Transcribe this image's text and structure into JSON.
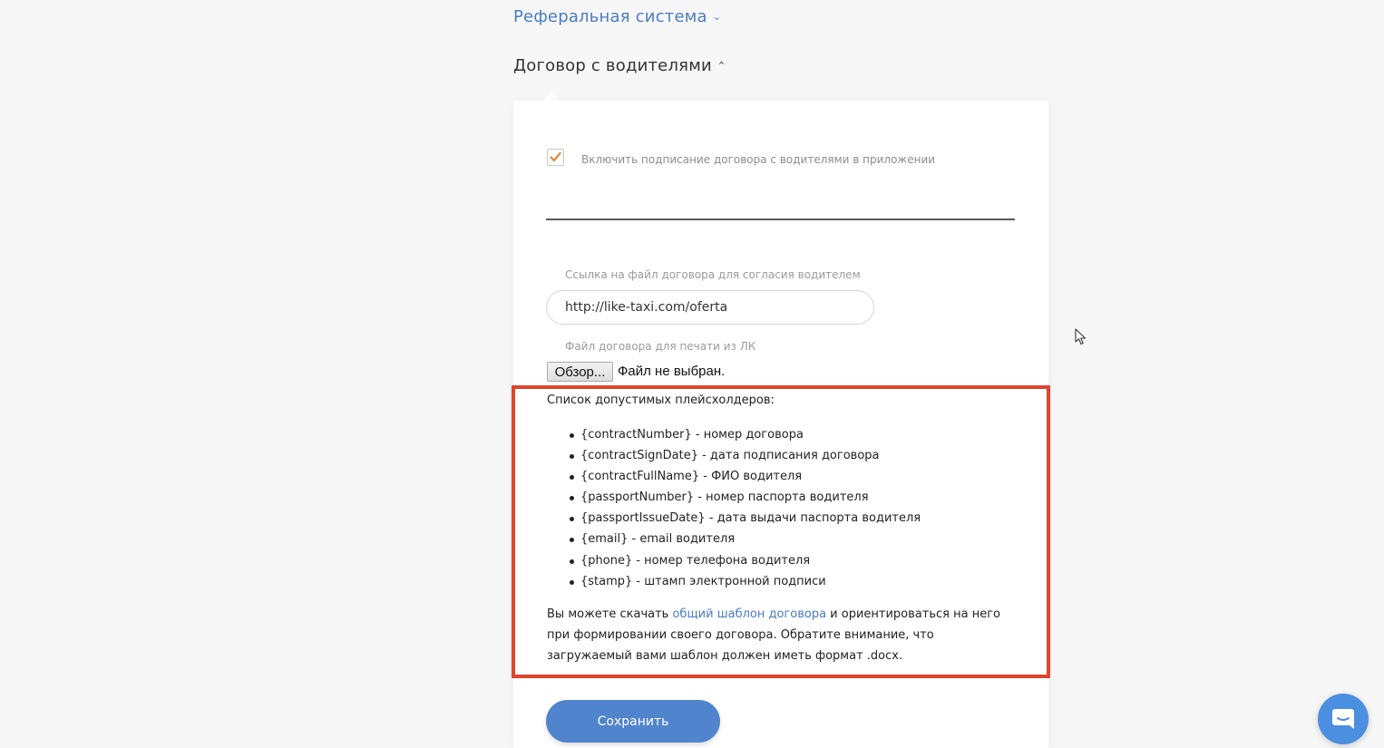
{
  "sections": {
    "referral": {
      "label": "Реферальная система",
      "chevron": "chevron-down-icon"
    },
    "contract": {
      "label": "Договор с водителями",
      "chevron": "chevron-up-icon"
    }
  },
  "settings": {
    "enable_signing": {
      "label": "Включить подписание договора с водителями в приложении",
      "checked": true
    },
    "contract_link": {
      "label": "Ссылка на файл договора для согласия водителем",
      "value": "http://like-taxi.com/oferta"
    },
    "print_file": {
      "label": "Файл договора для печати из ЛК",
      "browse_label": "Обзор...",
      "status": "Файл не выбран."
    }
  },
  "placeholders": {
    "title": "Список допустимых плейсхолдеров:",
    "items": [
      "{contractNumber} - номер договора",
      "{contractSignDate} - дата подписания договора",
      "{contractFullName} - ФИО водителя",
      "{passportNumber} - номер паспорта водителя",
      "{passportIssueDate} - дата выдачи паспорта водителя",
      "{email} - email водителя",
      "{phone} - номер телефона водителя",
      "{stamp} - штамп электронной подписи"
    ]
  },
  "note": {
    "before": "Вы можете скачать ",
    "link": "общий шаблон договора",
    "after": " и ориентироваться на него при формировании своего договора. Обратите внимание, что загружаемый вами шаблон должен иметь формат .docx."
  },
  "save_label": "Сохранить",
  "colors": {
    "accent": "#5084cc",
    "link": "#4a7cc1",
    "highlight": "#e0442e",
    "checkmark": "#e8863a",
    "chat": "#4a8fe0"
  },
  "icons": {
    "checkbox": "checkmark-icon",
    "cursor": "mouse-cursor-icon",
    "chat": "chat-icon"
  }
}
